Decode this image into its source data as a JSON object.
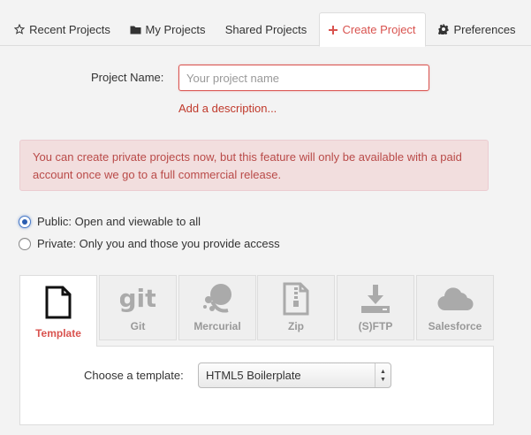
{
  "tabs": {
    "recent": {
      "label": "Recent Projects",
      "icon": "star-icon"
    },
    "mine": {
      "label": "My Projects",
      "icon": "folder-icon"
    },
    "shared": {
      "label": "Shared Projects"
    },
    "create": {
      "label": "Create Project",
      "icon": "plus-icon",
      "active": true
    },
    "prefs": {
      "label": "Preferences",
      "icon": "gear-icon"
    }
  },
  "form": {
    "name_label": "Project Name:",
    "name_placeholder": "Your project name",
    "name_value": "",
    "add_description": "Add a description..."
  },
  "alert": {
    "text": "You can create private projects now, but this feature will only be available with a paid account once we go to a full commercial release."
  },
  "visibility": {
    "public_label": "Public: Open and viewable to all",
    "private_label": "Private: Only you and those you provide access",
    "selected": "public"
  },
  "sources": {
    "items": [
      {
        "label": "Template",
        "icon": "document-icon",
        "active": true
      },
      {
        "label": "Git",
        "icon": "git-icon"
      },
      {
        "label": "Mercurial",
        "icon": "mercurial-icon"
      },
      {
        "label": "Zip",
        "icon": "zip-file-icon"
      },
      {
        "label": "(S)FTP",
        "icon": "download-icon"
      },
      {
        "label": "Salesforce",
        "icon": "cloud-icon"
      }
    ]
  },
  "template": {
    "choose_label": "Choose a template:",
    "selected": "HTML5 Boilerplate"
  },
  "colors": {
    "accent": "#d9534f",
    "alert_bg": "#f2dede",
    "alert_text": "#b94a48"
  }
}
